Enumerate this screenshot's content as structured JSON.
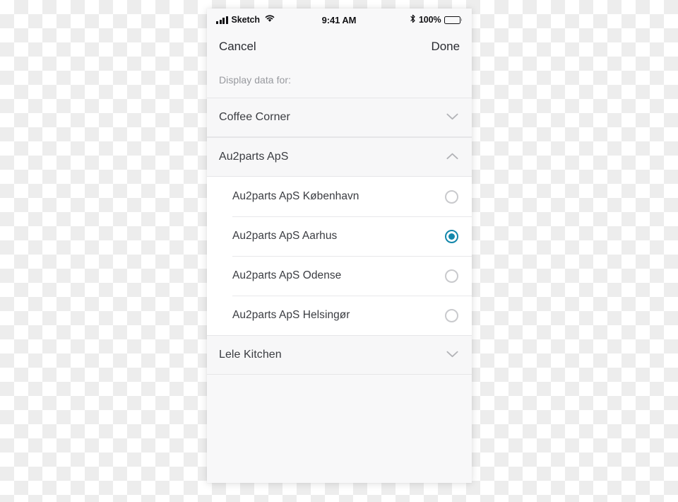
{
  "status_bar": {
    "carrier": "Sketch",
    "time": "9:41 AM",
    "battery_percent": "100%",
    "signal_icon": "signal-bars-icon",
    "wifi_icon": "wifi-icon",
    "bluetooth_icon": "bluetooth-icon",
    "battery_icon": "battery-full-icon"
  },
  "nav_bar": {
    "cancel_label": "Cancel",
    "done_label": "Done"
  },
  "subtitle": "Display data for:",
  "colors": {
    "accent": "#1387ab",
    "text": "#3a3c41",
    "muted_text": "#97999e",
    "divider": "#e6e6e8",
    "radio_border": "#c9cacd",
    "group_bg": "#f7f7f8",
    "screen_bg": "#f8f8f9"
  },
  "groups": [
    {
      "label": "Coffee Corner",
      "expanded": false,
      "chevron_icon": "chevron-down-icon",
      "options": []
    },
    {
      "label": "Au2parts ApS",
      "expanded": true,
      "chevron_icon": "chevron-up-icon",
      "options": [
        {
          "label": "Au2parts ApS København",
          "selected": false
        },
        {
          "label": "Au2parts ApS Aarhus",
          "selected": true
        },
        {
          "label": "Au2parts ApS Odense",
          "selected": false
        },
        {
          "label": "Au2parts ApS Helsingør",
          "selected": false
        }
      ]
    },
    {
      "label": "Lele Kitchen",
      "expanded": false,
      "chevron_icon": "chevron-down-icon",
      "options": []
    }
  ]
}
